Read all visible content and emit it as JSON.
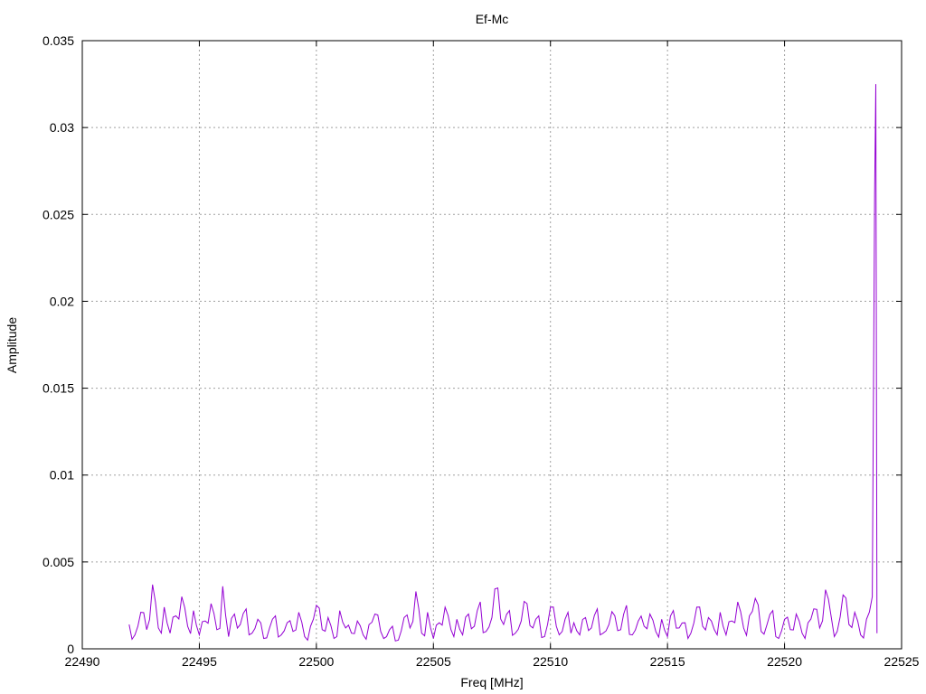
{
  "chart_data": {
    "type": "line",
    "title": "Ef-Mc",
    "xlabel": "Freq [MHz]",
    "ylabel": "Amplitude",
    "xlim": [
      22490,
      22525
    ],
    "ylim": [
      0,
      0.035
    ],
    "xticks": [
      "22490",
      "22495",
      "22500",
      "22505",
      "22510",
      "22515",
      "22520",
      "22525"
    ],
    "yticks": [
      "0",
      "0.005",
      "0.01",
      "0.015",
      "0.02",
      "0.025",
      "0.03",
      "0.035"
    ],
    "grid": true,
    "legend": "none",
    "series": [
      {
        "name": "Ef-Mc",
        "color": "#9400d3",
        "x_start": 22492,
        "x_step": 0.25,
        "values": [
          0.0014,
          0.0008,
          0.0021,
          0.0011,
          0.0037,
          0.0012,
          0.0024,
          0.0009,
          0.0019,
          0.003,
          0.0013,
          0.0022,
          0.0008,
          0.0016,
          0.0026,
          0.0011,
          0.0036,
          0.0007,
          0.002,
          0.0014,
          0.0023,
          0.0009,
          0.0017,
          0.0006,
          0.0012,
          0.0019,
          0.0008,
          0.0015,
          0.001,
          0.0021,
          0.0007,
          0.0013,
          0.0025,
          0.0011,
          0.0018,
          0.0006,
          0.0022,
          0.0012,
          0.0009,
          0.0016,
          0.0008,
          0.0014,
          0.002,
          0.001,
          0.0007,
          0.0013,
          0.0005,
          0.0018,
          0.0012,
          0.0033,
          0.0009,
          0.0021,
          0.0006,
          0.0015,
          0.0024,
          0.0011,
          0.0017,
          0.0008,
          0.002,
          0.0013,
          0.0027,
          0.001,
          0.0018,
          0.0035,
          0.0014,
          0.0022,
          0.0009,
          0.0016,
          0.0026,
          0.0012,
          0.0019,
          0.0007,
          0.0024,
          0.0013,
          0.001,
          0.0021,
          0.0015,
          0.0008,
          0.0018,
          0.0012,
          0.0023,
          0.0009,
          0.0014,
          0.0019,
          0.0011,
          0.0025,
          0.0008,
          0.0016,
          0.0013,
          0.002,
          0.001,
          0.0017,
          0.0007,
          0.0022,
          0.0012,
          0.0015,
          0.0009,
          0.0024,
          0.0013,
          0.0018,
          0.0011,
          0.0021,
          0.0008,
          0.0016,
          0.0027,
          0.0012,
          0.0019,
          0.0029,
          0.001,
          0.0014,
          0.0022,
          0.0006,
          0.0017,
          0.0011,
          0.002,
          0.0009,
          0.0015,
          0.0023,
          0.0012,
          0.0034,
          0.0018,
          0.001,
          0.0031,
          0.0014,
          0.0021,
          0.0008,
          0.0017,
          0.003
        ],
        "extra_points": [
          [
            22523.85,
            0.0263
          ],
          [
            22523.9,
            0.0325
          ],
          [
            22523.95,
            0.0009
          ]
        ]
      }
    ]
  }
}
